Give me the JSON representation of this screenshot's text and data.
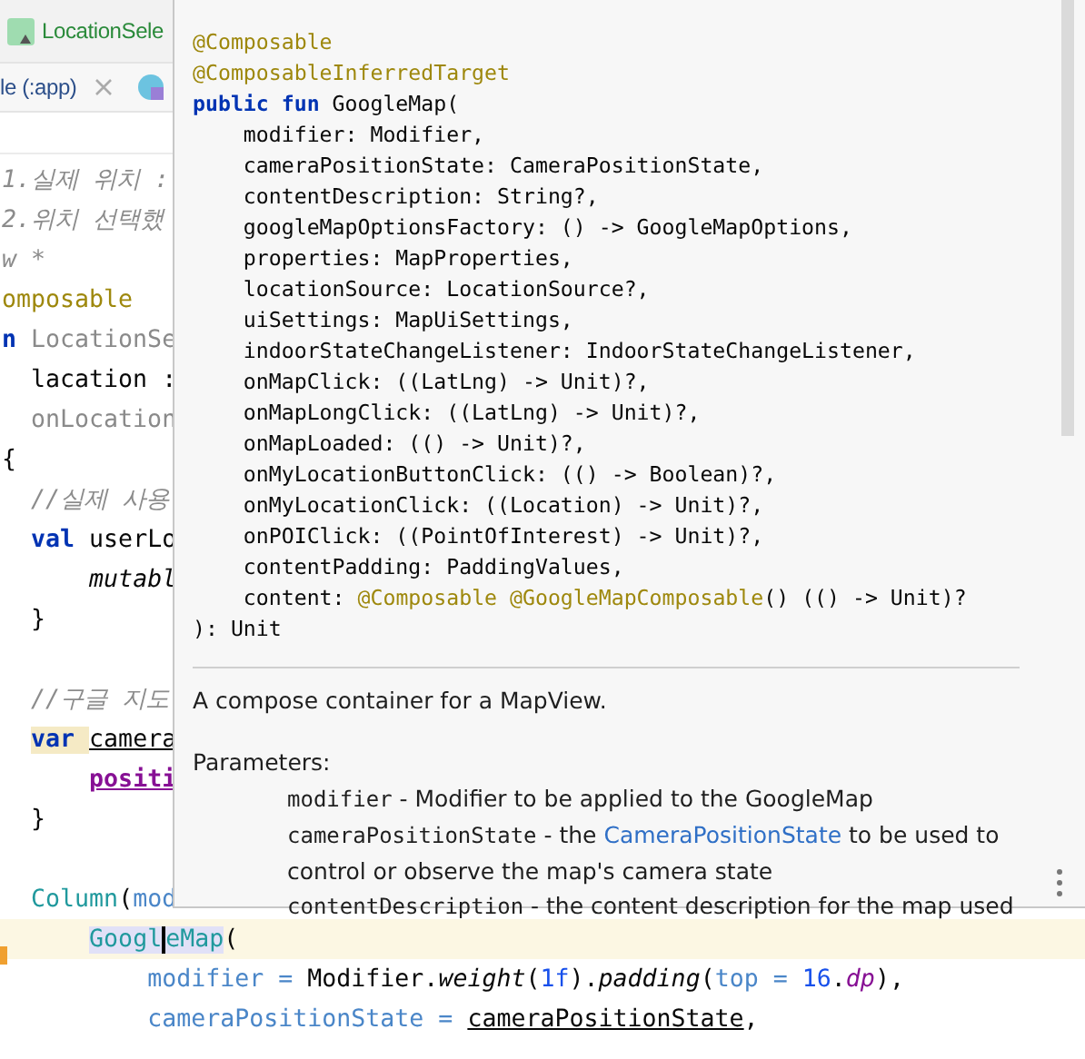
{
  "tabs": [
    {
      "label": "LocationSele",
      "selected": true,
      "kind": "file"
    },
    {
      "label": "le (:app)",
      "selected": false,
      "kind": "module"
    }
  ],
  "editor": {
    "lines": [
      {
        "current": false,
        "tokens": [
          {
            "text": "1.실제 위치 :",
            "kind": "comment"
          }
        ]
      },
      {
        "current": false,
        "tokens": [
          {
            "text": "2.위치 선택했",
            "kind": "comment"
          }
        ]
      },
      {
        "current": false,
        "tokens": [
          {
            "text": "w *",
            "kind": "comment"
          }
        ]
      },
      {
        "current": false,
        "tokens": [
          {
            "text": "omposable",
            "kind": "annotation"
          }
        ]
      },
      {
        "current": false,
        "tokens": [
          {
            "text": "n ",
            "kind": "keyword"
          },
          {
            "text": "LocationSe",
            "kind": "muted"
          }
        ]
      },
      {
        "current": false,
        "tokens": [
          {
            "text": "  lacation :",
            "kind": "plain"
          }
        ]
      },
      {
        "current": false,
        "tokens": [
          {
            "text": "  onLocation",
            "kind": "muted"
          }
        ]
      },
      {
        "current": false,
        "tokens": [
          {
            "text": "{",
            "kind": "plain"
          }
        ]
      },
      {
        "current": false,
        "tokens": [
          {
            "text": "  //실제 사용",
            "kind": "comment"
          }
        ]
      },
      {
        "current": false,
        "tokens": [
          {
            "text": "  val ",
            "kind": "keyword"
          },
          {
            "text": "userLo",
            "kind": "plain"
          }
        ]
      },
      {
        "current": false,
        "tokens": [
          {
            "text": "      mutabl",
            "kind": "italic"
          }
        ]
      },
      {
        "current": false,
        "tokens": [
          {
            "text": "  }",
            "kind": "plain"
          }
        ]
      },
      {
        "current": false
      },
      {
        "current": false,
        "tokens": [
          {
            "text": "  //구글 지도",
            "kind": "comment"
          }
        ]
      },
      {
        "current": false,
        "tokens": [
          {
            "text": "  var ",
            "kind": "keyword-marked"
          },
          {
            "text": "camera",
            "kind": "var"
          }
        ]
      },
      {
        "current": false,
        "tokens": [
          {
            "text": "      positi",
            "kind": "property"
          }
        ]
      },
      {
        "current": false,
        "tokens": [
          {
            "text": "  }",
            "kind": "plain"
          }
        ]
      },
      {
        "current": false
      },
      {
        "current": false,
        "tokens": [
          {
            "text": "  Column",
            "kind": "fn"
          },
          {
            "text": "(",
            "kind": "plain"
          },
          {
            "text": "mod",
            "kind": "param"
          }
        ]
      },
      {
        "current": true,
        "tokens": [
          {
            "text": "      Googl",
            "kind": "fn-ref"
          },
          {
            "text": "eMap",
            "kind": "fn-ref",
            "caret": true
          },
          {
            "text": "(",
            "kind": "plain"
          }
        ]
      },
      {
        "current": false,
        "tokens": [
          {
            "text": "          modifier = ",
            "kind": "param"
          },
          {
            "text": "Modifier.",
            "kind": "plain"
          },
          {
            "text": "weight",
            "kind": "italic"
          },
          {
            "text": "(",
            "kind": "plain"
          },
          {
            "text": "1f",
            "kind": "number"
          },
          {
            "text": ").",
            "kind": "plain"
          },
          {
            "text": "padding",
            "kind": "italic"
          },
          {
            "text": "(",
            "kind": "plain"
          },
          {
            "text": "top = ",
            "kind": "param"
          },
          {
            "text": "16",
            "kind": "number"
          },
          {
            "text": ".",
            "kind": "plain"
          },
          {
            "text": "dp",
            "kind": "ext"
          },
          {
            "text": "),",
            "kind": "plain"
          }
        ]
      },
      {
        "current": false,
        "tokens": [
          {
            "text": "          cameraPositionState = ",
            "kind": "param"
          },
          {
            "text": "cameraPositionState",
            "kind": "var"
          },
          {
            "text": ",",
            "kind": "plain"
          }
        ]
      }
    ]
  },
  "popup": {
    "signature": [
      {
        "tokens": [
          {
            "text": "@Composable",
            "kind": "annotation"
          }
        ]
      },
      {
        "tokens": [
          {
            "text": "@ComposableInferredTarget",
            "kind": "annotation"
          }
        ]
      },
      {
        "tokens": [
          {
            "text": "public fun ",
            "kind": "keyword"
          },
          {
            "text": "GoogleMap(",
            "kind": "plain"
          }
        ]
      },
      {
        "tokens": [
          {
            "text": "    modifier: Modifier,",
            "kind": "plain"
          }
        ]
      },
      {
        "tokens": [
          {
            "text": "    cameraPositionState: CameraPositionState,",
            "kind": "plain"
          }
        ]
      },
      {
        "tokens": [
          {
            "text": "    contentDescription: String?,",
            "kind": "plain"
          }
        ]
      },
      {
        "tokens": [
          {
            "text": "    googleMapOptionsFactory: () -> GoogleMapOptions,",
            "kind": "plain"
          }
        ]
      },
      {
        "tokens": [
          {
            "text": "    properties: MapProperties,",
            "kind": "plain"
          }
        ]
      },
      {
        "tokens": [
          {
            "text": "    locationSource: LocationSource?,",
            "kind": "plain"
          }
        ]
      },
      {
        "tokens": [
          {
            "text": "    uiSettings: MapUiSettings,",
            "kind": "plain"
          }
        ]
      },
      {
        "tokens": [
          {
            "text": "    indoorStateChangeListener: IndoorStateChangeListener,",
            "kind": "plain"
          }
        ]
      },
      {
        "tokens": [
          {
            "text": "    onMapClick: ((LatLng) -> Unit)?,",
            "kind": "plain"
          }
        ]
      },
      {
        "tokens": [
          {
            "text": "    onMapLongClick: ((LatLng) -> Unit)?,",
            "kind": "plain"
          }
        ]
      },
      {
        "tokens": [
          {
            "text": "    onMapLoaded: (() -> Unit)?,",
            "kind": "plain"
          }
        ]
      },
      {
        "tokens": [
          {
            "text": "    onMyLocationButtonClick: (() -> Boolean)?,",
            "kind": "plain"
          }
        ]
      },
      {
        "tokens": [
          {
            "text": "    onMyLocationClick: ((Location) -> Unit)?,",
            "kind": "plain"
          }
        ]
      },
      {
        "tokens": [
          {
            "text": "    onPOIClick: ((PointOfInterest) -> Unit)?,",
            "kind": "plain"
          }
        ]
      },
      {
        "tokens": [
          {
            "text": "    contentPadding: PaddingValues,",
            "kind": "plain"
          }
        ]
      },
      {
        "tokens": [
          {
            "text": "    content: ",
            "kind": "plain"
          },
          {
            "text": "@Composable @GoogleMapComposable",
            "kind": "annotation"
          },
          {
            "text": "() (() -> Unit)?",
            "kind": "plain"
          }
        ]
      },
      {
        "tokens": [
          {
            "text": "): Unit",
            "kind": "plain"
          }
        ]
      }
    ],
    "description": "A compose container for a MapView.",
    "parameters_label": "Parameters:",
    "parameters": [
      {
        "name": "modifier",
        "parts": [
          {
            "text": " - Modifier to be applied to the GoogleMap",
            "kind": "text"
          }
        ]
      },
      {
        "name": "cameraPositionState",
        "parts": [
          {
            "text": " - the ",
            "kind": "text"
          },
          {
            "text": "CameraPositionState",
            "kind": "link"
          },
          {
            "text": " to be used to control or observe the map's camera state",
            "kind": "text"
          }
        ]
      },
      {
        "name": "contentDescription",
        "parts": [
          {
            "text": " - the content description for the map used",
            "kind": "text"
          }
        ]
      }
    ]
  }
}
